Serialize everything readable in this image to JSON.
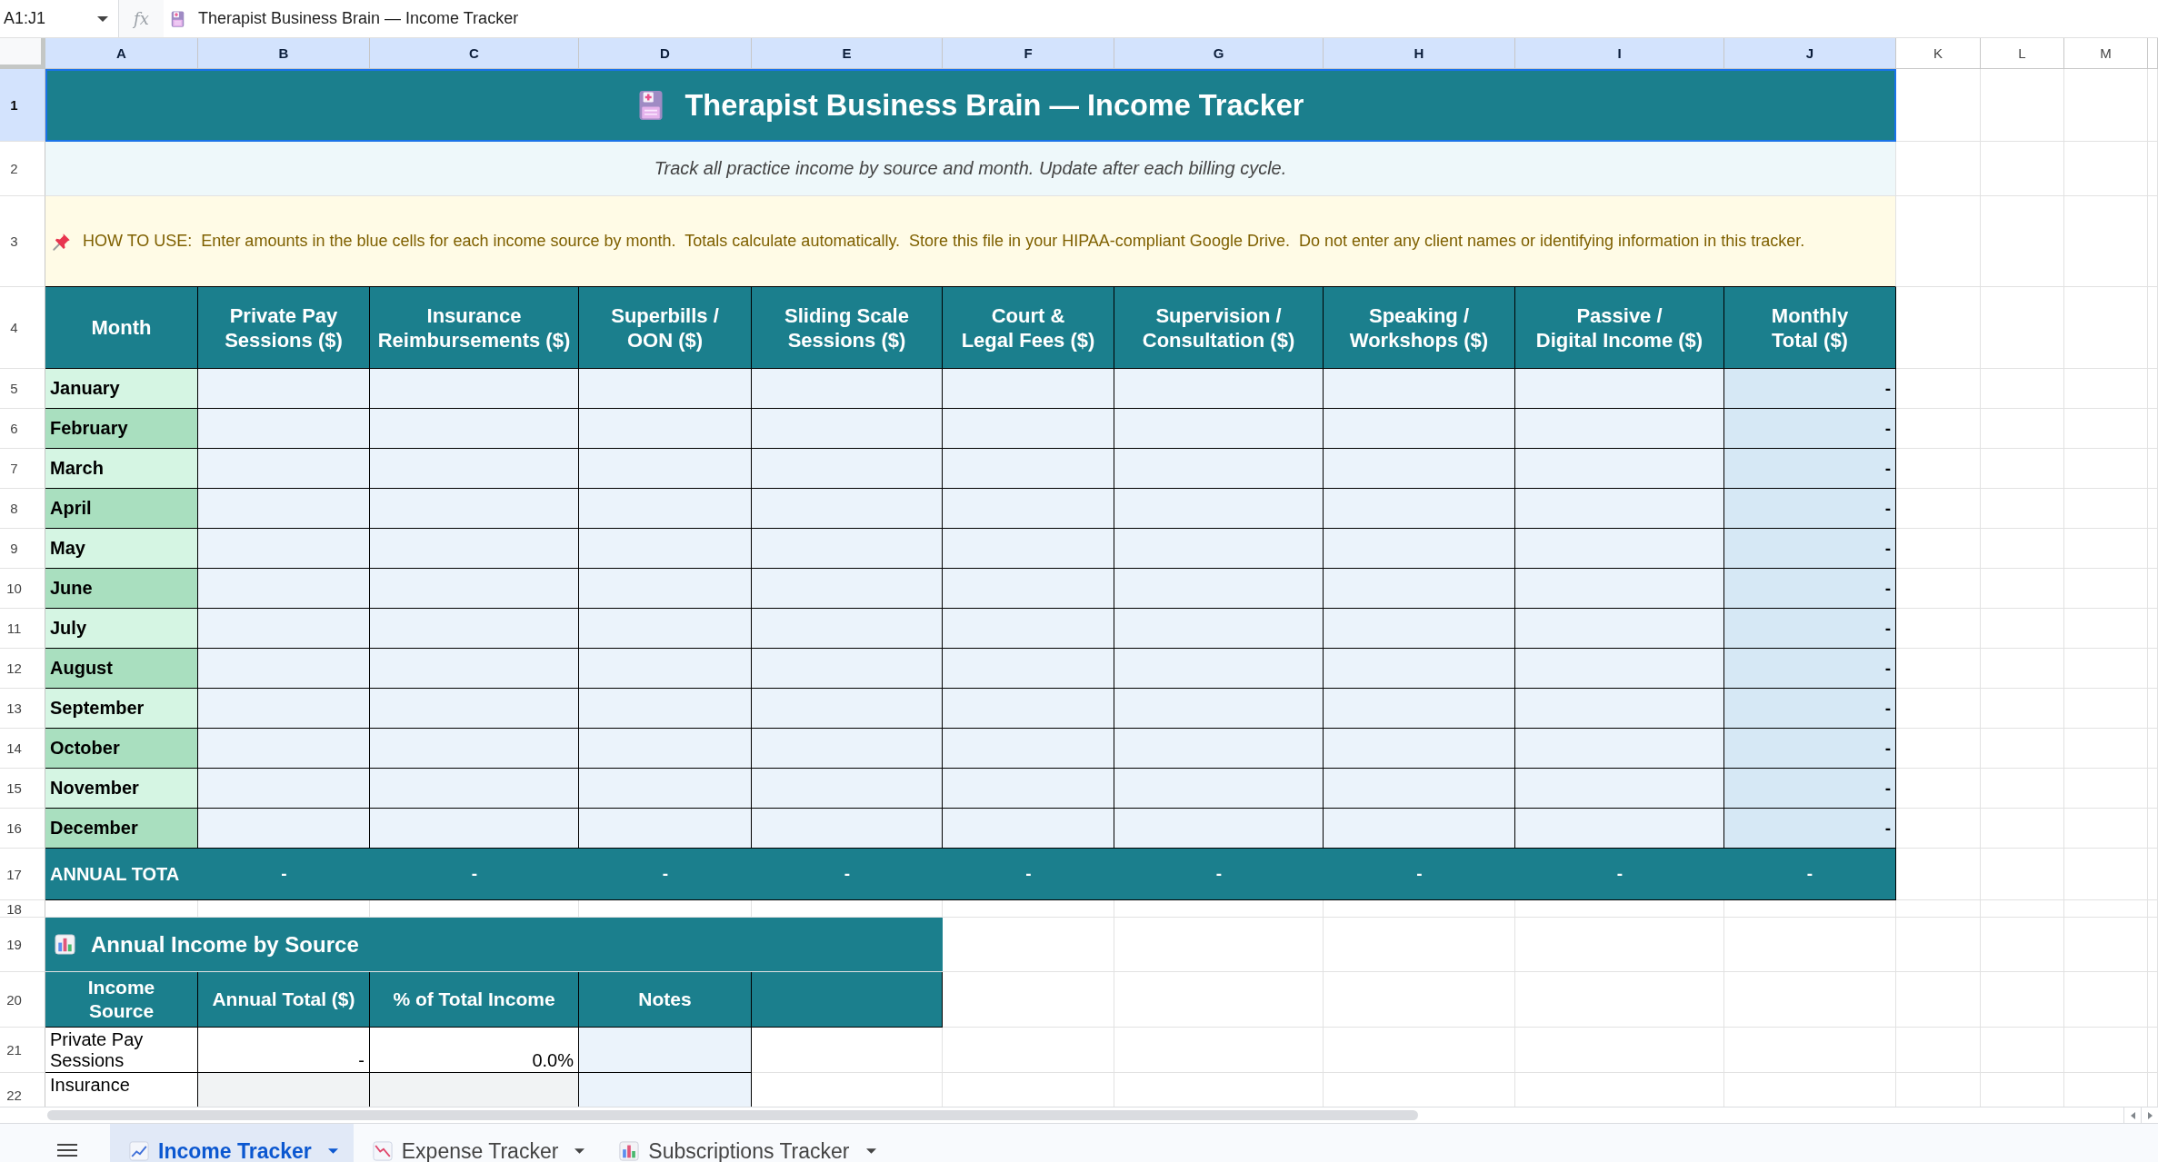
{
  "formula_bar": {
    "name_box": "A1:J1",
    "fx": "fx",
    "formula": "Therapist Business Brain — Income Tracker"
  },
  "column_headers": [
    {
      "label": "A",
      "selected": true
    },
    {
      "label": "B",
      "selected": true
    },
    {
      "label": "C",
      "selected": true
    },
    {
      "label": "D",
      "selected": true
    },
    {
      "label": "E",
      "selected": true
    },
    {
      "label": "F",
      "selected": true
    },
    {
      "label": "G",
      "selected": true
    },
    {
      "label": "H",
      "selected": true
    },
    {
      "label": "I",
      "selected": true
    },
    {
      "label": "J",
      "selected": true
    },
    {
      "label": "K",
      "selected": false
    },
    {
      "label": "L",
      "selected": false
    },
    {
      "label": "M",
      "selected": false
    }
  ],
  "row_headers": [
    {
      "label": "1",
      "selected": true
    },
    {
      "label": "2",
      "selected": false
    },
    {
      "label": "3",
      "selected": false
    },
    {
      "label": "4",
      "selected": false
    },
    {
      "label": "5",
      "selected": false
    },
    {
      "label": "6",
      "selected": false
    },
    {
      "label": "7",
      "selected": false
    },
    {
      "label": "8",
      "selected": false
    },
    {
      "label": "9",
      "selected": false
    },
    {
      "label": "10",
      "selected": false
    },
    {
      "label": "11",
      "selected": false
    },
    {
      "label": "12",
      "selected": false
    },
    {
      "label": "13",
      "selected": false
    },
    {
      "label": "14",
      "selected": false
    },
    {
      "label": "15",
      "selected": false
    },
    {
      "label": "16",
      "selected": false
    },
    {
      "label": "17",
      "selected": false
    },
    {
      "label": "18",
      "selected": false
    },
    {
      "label": "19",
      "selected": false
    },
    {
      "label": "20",
      "selected": false
    },
    {
      "label": "21",
      "selected": false
    },
    {
      "label": "22",
      "selected": false
    }
  ],
  "title": {
    "text": "Therapist Business Brain — Income Tracker",
    "selected": true
  },
  "subtitle": "Track all practice income by source and month. Update after each billing cycle.",
  "instructions": "HOW TO USE:  Enter amounts in the blue cells for each income source by month.  Totals calculate automatically.  Store this file in your HIPAA-compliant Google Drive.  Do not enter any client names or identifying information in this tracker.",
  "income_table": {
    "columns": [
      "Month",
      "Private Pay\nSessions ($)",
      "Insurance\nReimbursements ($)",
      "Superbills /\nOON ($)",
      "Sliding Scale\nSessions ($)",
      "Court &\nLegal Fees ($)",
      "Supervision /\nConsultation ($)",
      "Speaking /\nWorkshops ($)",
      "Passive /\nDigital Income ($)",
      "Monthly\nTotal ($)"
    ],
    "rows": [
      {
        "month": "January",
        "monthly_total": "-"
      },
      {
        "month": "February",
        "monthly_total": "-"
      },
      {
        "month": "March",
        "monthly_total": "-"
      },
      {
        "month": "April",
        "monthly_total": "-"
      },
      {
        "month": "May",
        "monthly_total": "-"
      },
      {
        "month": "June",
        "monthly_total": "-"
      },
      {
        "month": "July",
        "monthly_total": "-"
      },
      {
        "month": "August",
        "monthly_total": "-"
      },
      {
        "month": "September",
        "monthly_total": "-"
      },
      {
        "month": "October",
        "monthly_total": "-"
      },
      {
        "month": "November",
        "monthly_total": "-"
      },
      {
        "month": "December",
        "monthly_total": "-"
      }
    ],
    "annual_total": {
      "label": "ANNUAL TOTA",
      "values": [
        "-",
        "-",
        "-",
        "-",
        "-",
        "-",
        "-",
        "-",
        "-"
      ]
    }
  },
  "source_summary": {
    "title": "Annual Income by Source",
    "columns": [
      "Income\nSource",
      "Annual Total ($)",
      "% of Total Income",
      "Notes"
    ],
    "rows": [
      {
        "source": "Private Pay Sessions",
        "annual_total": "-",
        "share": "0.0%"
      },
      {
        "source": "Insurance"
      }
    ]
  },
  "sheet_tabs": [
    {
      "label": "Income Tracker",
      "selected": true
    },
    {
      "label": "Expense Tracker",
      "selected": false
    },
    {
      "label": "Subscriptions Tracker",
      "selected": false
    }
  ]
}
